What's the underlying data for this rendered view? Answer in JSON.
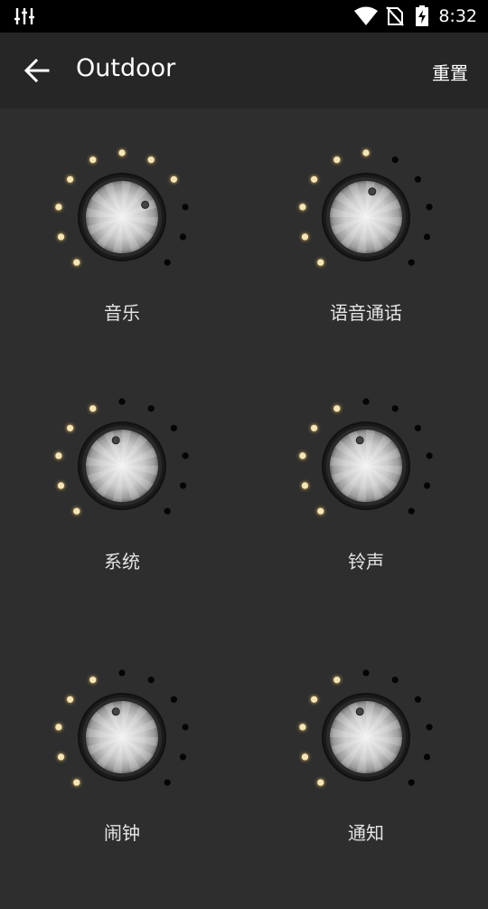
{
  "status_bar": {
    "time": "8:32",
    "icons": [
      "equalizer-icon",
      "wifi-icon",
      "no-sim-icon",
      "battery-charging-icon"
    ]
  },
  "app_bar": {
    "back_icon": "arrow-left-icon",
    "title": "Outdoor",
    "reset_label": "重置"
  },
  "colors": {
    "background": "#2e2e2e",
    "app_bar": "#262626",
    "led_on": "#f5e6b8",
    "led_off": "#050505"
  },
  "knobs": [
    {
      "label": "音乐",
      "level": 0.73,
      "leds_on": 8,
      "leds_total": 11
    },
    {
      "label": "语音通话",
      "level": 0.55,
      "leds_on": 6,
      "leds_total": 11
    },
    {
      "label": "系统",
      "level": 0.45,
      "leds_on": 5,
      "leds_total": 11
    },
    {
      "label": "铃声",
      "level": 0.45,
      "leds_on": 5,
      "leds_total": 11
    },
    {
      "label": "闹钟",
      "level": 0.45,
      "leds_on": 5,
      "leds_total": 11
    },
    {
      "label": "通知",
      "level": 0.45,
      "leds_on": 5,
      "leds_total": 11
    }
  ]
}
